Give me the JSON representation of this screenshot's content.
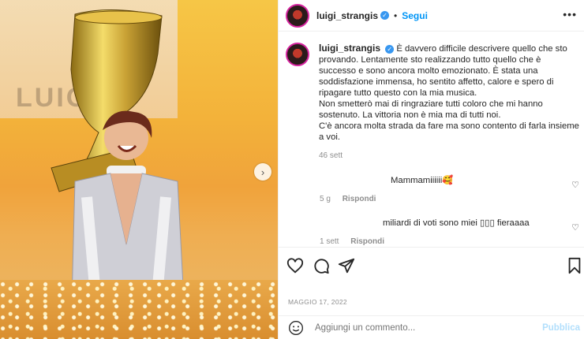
{
  "post": {
    "username": "luigi_strangis",
    "follow_label": "Segui",
    "more_label": "•••",
    "caption_lines": [
      "È davvero difficile descrivere quello che sto provando. Lentamente sto realizzando tutto quello che è successo e sono ancora molto emozionato. È stata una soddisfazione immensa, ho sentito affetto, calore e spero di ripagare tutto questo con la mia musica.",
      "Non smetterò mai di ringraziare tutti coloro che mi hanno sostenuto. La vittoria non è mia ma di tutti noi.",
      "C'è ancora molta strada da fare ma sono contento di farla insieme a voi."
    ],
    "caption_time": "46 sett",
    "date": "MAGGIO 17, 2022"
  },
  "media": {
    "banner_text": "LUIGI"
  },
  "comments": [
    {
      "text": "Mammamiiiiii🥰",
      "time": "5 g",
      "reply": "Rispondi"
    },
    {
      "text": "miliardi di voti sono miei ▯▯▯ fieraaaa",
      "time": "1 sett",
      "reply": "Rispondi"
    }
  ],
  "composer": {
    "placeholder": "Aggiungi un commento...",
    "publish": "Pubblica"
  },
  "colors": {
    "accent": "#0095f6",
    "verified": "#3897f0",
    "publish_disabled": "#b2dffc"
  }
}
